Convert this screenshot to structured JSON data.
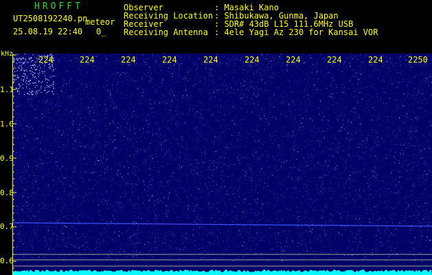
{
  "header": {
    "brand": "HROFFT",
    "filename": "UT2508192240.pn",
    "mode": "meteor",
    "datetime": "25.08.19 22:40",
    "count": "0_",
    "meta": [
      {
        "label": "Observer",
        "value": "Masaki Kano"
      },
      {
        "label": "Receiving Location",
        "value": "Shibukawa, Gunma, Japan"
      },
      {
        "label": "Receiver",
        "value": "SDR# 43dB L15 111.6MHz USB"
      },
      {
        "label": "Receiving Antenna",
        "value": "4ele Yagi Az 230 for Kansai VOR"
      }
    ]
  },
  "spectrogram": {
    "y_unit": "kHz",
    "y_ticks": [
      "1.1",
      "1.0",
      "0.9",
      "0.8",
      "0.7",
      "0.6"
    ],
    "time_labels": [
      "224",
      "224",
      "224",
      "224",
      "224",
      "224",
      "224",
      "224",
      "224",
      "2250"
    ],
    "colors": {
      "background": "#000066",
      "signal": "#4466ff",
      "trace": "#00ffff",
      "grid": "#ffff00"
    }
  }
}
